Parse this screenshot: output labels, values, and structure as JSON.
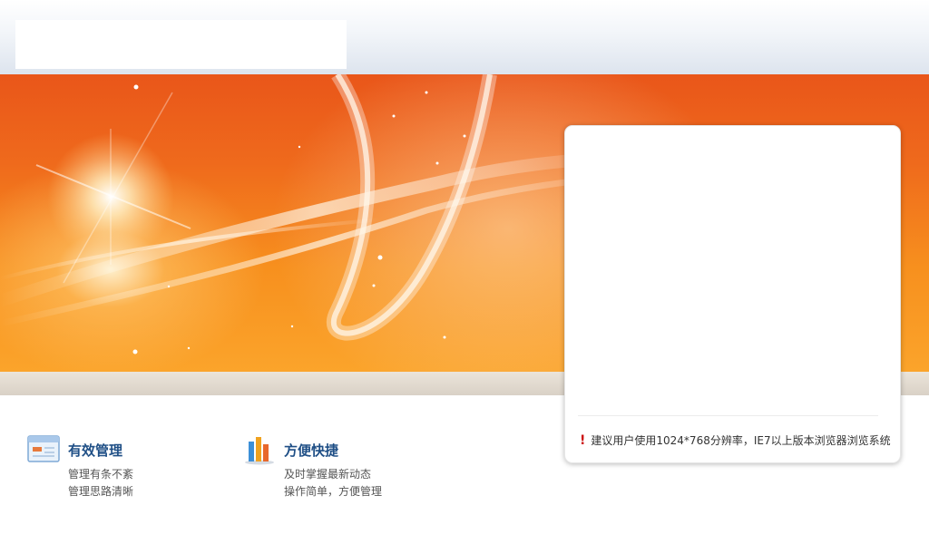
{
  "header": {
    "logo_text": ""
  },
  "banner": {
    "colors": {
      "top": "#e9561a",
      "bottom": "#fba42b",
      "glow": "#fff5d7"
    }
  },
  "login": {
    "notice": "建议用户使用1024*768分辨率，IE7以上版本浏览器浏览系统",
    "notice_icon": "exclamation-icon"
  },
  "features": [
    {
      "icon": "window-icon",
      "title": "有效管理",
      "lines": [
        "管理有条不紊",
        "管理思路清晰"
      ]
    },
    {
      "icon": "bar-chart-icon",
      "title": "方便快捷",
      "lines": [
        "及时掌握最新动态",
        "操作简单，方便管理"
      ]
    }
  ]
}
